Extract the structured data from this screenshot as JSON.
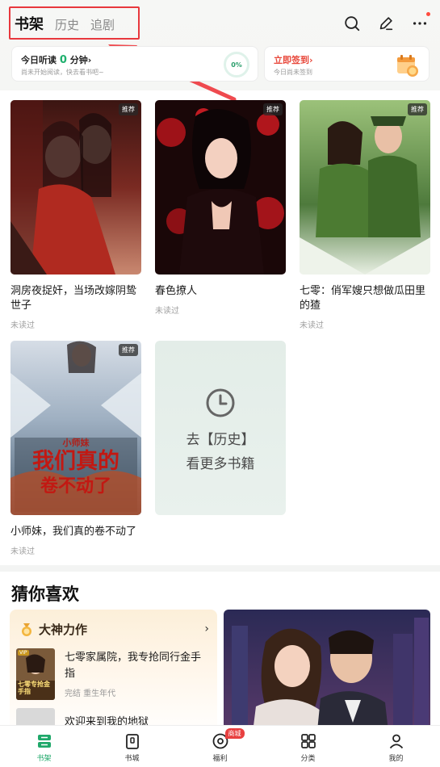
{
  "header": {
    "tabs": [
      "书架",
      "历史",
      "追剧"
    ],
    "icons": [
      "search-icon",
      "edit-icon",
      "more-icon"
    ]
  },
  "reading": {
    "title_prefix": "今日听读",
    "minutes": "0",
    "title_suffix": "分钟",
    "chevron": "›",
    "subtitle": "尚未开始阅读，快去看书吧~",
    "percent": "0%"
  },
  "signin": {
    "title": "立即签到",
    "chevron": "›",
    "subtitle": "今日尚未签到"
  },
  "books": [
    {
      "title": "洞房夜捉奸，当场改嫁阴鸷世子",
      "status": "未读过",
      "badge": "推荐"
    },
    {
      "title": "春色撩人",
      "status": "未读过",
      "badge": "推荐"
    },
    {
      "title": "七零：俏军嫂只想做瓜田里的猹",
      "status": "未读过",
      "badge": "推荐"
    },
    {
      "title": "小师妹，我们真的卷不动了",
      "status": "未读过",
      "badge": "推荐",
      "cover_text_top": "小师妹",
      "cover_text_mid": "我们真的",
      "cover_text_bottom": "卷不动了"
    }
  ],
  "history_card": {
    "line1": "去【历史】",
    "line2": "看更多书籍"
  },
  "guess": {
    "title": "猜你喜欢",
    "section_title": "大神力作",
    "arrow": "›",
    "book1_title": "七零家属院，我专抢同行金手指",
    "book1_meta": "完结 重生年代",
    "book1_cover_text": "七零专抢金手指",
    "book1_badge": "VIP",
    "book2_title": "欢迎来到我的地狱"
  },
  "nav": {
    "items": [
      "书架",
      "书城",
      "福利",
      "分类",
      "我的"
    ],
    "badge": "商城",
    "active": "书架"
  },
  "colors": {
    "accent_green": "#1fa86a",
    "highlight_red": "#e8383d"
  }
}
